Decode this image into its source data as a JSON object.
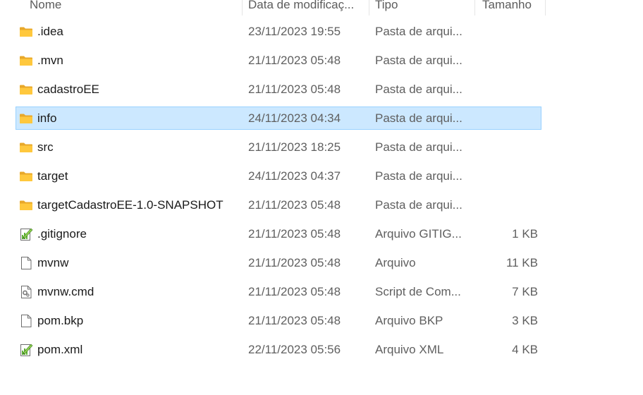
{
  "columns": {
    "name": "Nome",
    "date": "Data de modificaç...",
    "type": "Tipo",
    "size": "Tamanho"
  },
  "files": [
    {
      "name": ".idea",
      "date": "23/11/2023 19:55",
      "type": "Pasta de arqui...",
      "size": "",
      "icon": "folder-icon"
    },
    {
      "name": ".mvn",
      "date": "21/11/2023 05:48",
      "type": "Pasta de arqui...",
      "size": "",
      "icon": "folder-icon"
    },
    {
      "name": "cadastroEE",
      "date": "21/11/2023 05:48",
      "type": "Pasta de arqui...",
      "size": "",
      "icon": "folder-icon"
    },
    {
      "name": "info",
      "date": "24/11/2023 04:34",
      "type": "Pasta de arqui...",
      "size": "",
      "icon": "folder-icon",
      "selected": true
    },
    {
      "name": "src",
      "date": "21/11/2023 18:25",
      "type": "Pasta de arqui...",
      "size": "",
      "icon": "folder-icon"
    },
    {
      "name": "target",
      "date": "24/11/2023 04:37",
      "type": "Pasta de arqui...",
      "size": "",
      "icon": "folder-icon"
    },
    {
      "name": "targetCadastroEE-1.0-SNAPSHOT",
      "date": "21/11/2023 05:48",
      "type": "Pasta de arqui...",
      "size": "",
      "icon": "folder-icon"
    },
    {
      "name": ".gitignore",
      "date": "21/11/2023 05:48",
      "type": "Arquivo GITIG...",
      "size": "1 KB",
      "icon": "notepad-plus-file-icon"
    },
    {
      "name": "mvnw",
      "date": "21/11/2023 05:48",
      "type": "Arquivo",
      "size": "11 KB",
      "icon": "blank-file-icon"
    },
    {
      "name": "mvnw.cmd",
      "date": "21/11/2023 05:48",
      "type": "Script de Com...",
      "size": "7 KB",
      "icon": "cmd-script-file-icon"
    },
    {
      "name": "pom.bkp",
      "date": "21/11/2023 05:48",
      "type": "Arquivo BKP",
      "size": "3 KB",
      "icon": "blank-file-icon"
    },
    {
      "name": "pom.xml",
      "date": "22/11/2023 05:56",
      "type": "Arquivo XML",
      "size": "4 KB",
      "icon": "notepad-plus-file-icon"
    }
  ],
  "colors": {
    "selection_bg": "#cce8ff",
    "selection_border": "#99d1ff",
    "folder": "#ffc83d"
  }
}
